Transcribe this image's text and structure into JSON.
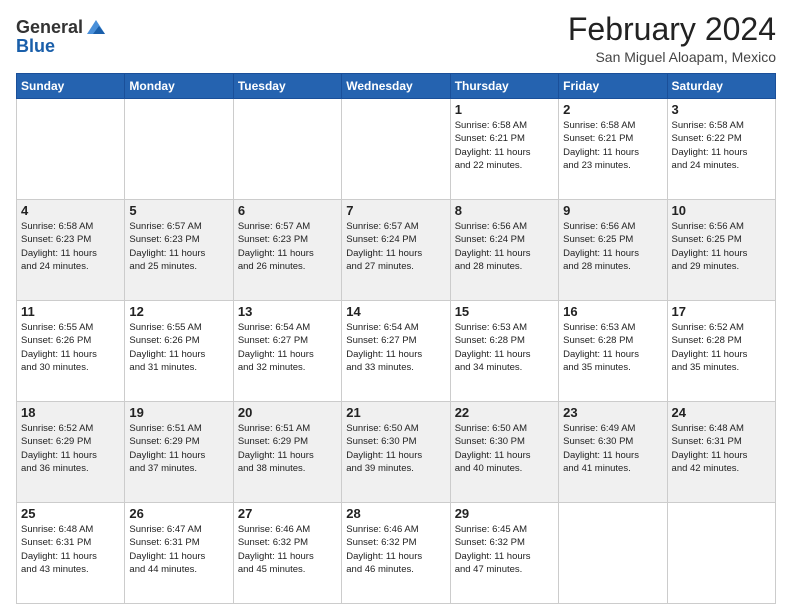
{
  "header": {
    "logo": {
      "line1": "General",
      "line2": "Blue"
    },
    "title": "February 2024",
    "location": "San Miguel Aloapam, Mexico"
  },
  "days_of_week": [
    "Sunday",
    "Monday",
    "Tuesday",
    "Wednesday",
    "Thursday",
    "Friday",
    "Saturday"
  ],
  "weeks": [
    [
      {
        "day": "",
        "info": ""
      },
      {
        "day": "",
        "info": ""
      },
      {
        "day": "",
        "info": ""
      },
      {
        "day": "",
        "info": ""
      },
      {
        "day": "1",
        "info": "Sunrise: 6:58 AM\nSunset: 6:21 PM\nDaylight: 11 hours\nand 22 minutes."
      },
      {
        "day": "2",
        "info": "Sunrise: 6:58 AM\nSunset: 6:21 PM\nDaylight: 11 hours\nand 23 minutes."
      },
      {
        "day": "3",
        "info": "Sunrise: 6:58 AM\nSunset: 6:22 PM\nDaylight: 11 hours\nand 24 minutes."
      }
    ],
    [
      {
        "day": "4",
        "info": "Sunrise: 6:58 AM\nSunset: 6:23 PM\nDaylight: 11 hours\nand 24 minutes."
      },
      {
        "day": "5",
        "info": "Sunrise: 6:57 AM\nSunset: 6:23 PM\nDaylight: 11 hours\nand 25 minutes."
      },
      {
        "day": "6",
        "info": "Sunrise: 6:57 AM\nSunset: 6:23 PM\nDaylight: 11 hours\nand 26 minutes."
      },
      {
        "day": "7",
        "info": "Sunrise: 6:57 AM\nSunset: 6:24 PM\nDaylight: 11 hours\nand 27 minutes."
      },
      {
        "day": "8",
        "info": "Sunrise: 6:56 AM\nSunset: 6:24 PM\nDaylight: 11 hours\nand 28 minutes."
      },
      {
        "day": "9",
        "info": "Sunrise: 6:56 AM\nSunset: 6:25 PM\nDaylight: 11 hours\nand 28 minutes."
      },
      {
        "day": "10",
        "info": "Sunrise: 6:56 AM\nSunset: 6:25 PM\nDaylight: 11 hours\nand 29 minutes."
      }
    ],
    [
      {
        "day": "11",
        "info": "Sunrise: 6:55 AM\nSunset: 6:26 PM\nDaylight: 11 hours\nand 30 minutes."
      },
      {
        "day": "12",
        "info": "Sunrise: 6:55 AM\nSunset: 6:26 PM\nDaylight: 11 hours\nand 31 minutes."
      },
      {
        "day": "13",
        "info": "Sunrise: 6:54 AM\nSunset: 6:27 PM\nDaylight: 11 hours\nand 32 minutes."
      },
      {
        "day": "14",
        "info": "Sunrise: 6:54 AM\nSunset: 6:27 PM\nDaylight: 11 hours\nand 33 minutes."
      },
      {
        "day": "15",
        "info": "Sunrise: 6:53 AM\nSunset: 6:28 PM\nDaylight: 11 hours\nand 34 minutes."
      },
      {
        "day": "16",
        "info": "Sunrise: 6:53 AM\nSunset: 6:28 PM\nDaylight: 11 hours\nand 35 minutes."
      },
      {
        "day": "17",
        "info": "Sunrise: 6:52 AM\nSunset: 6:28 PM\nDaylight: 11 hours\nand 35 minutes."
      }
    ],
    [
      {
        "day": "18",
        "info": "Sunrise: 6:52 AM\nSunset: 6:29 PM\nDaylight: 11 hours\nand 36 minutes."
      },
      {
        "day": "19",
        "info": "Sunrise: 6:51 AM\nSunset: 6:29 PM\nDaylight: 11 hours\nand 37 minutes."
      },
      {
        "day": "20",
        "info": "Sunrise: 6:51 AM\nSunset: 6:29 PM\nDaylight: 11 hours\nand 38 minutes."
      },
      {
        "day": "21",
        "info": "Sunrise: 6:50 AM\nSunset: 6:30 PM\nDaylight: 11 hours\nand 39 minutes."
      },
      {
        "day": "22",
        "info": "Sunrise: 6:50 AM\nSunset: 6:30 PM\nDaylight: 11 hours\nand 40 minutes."
      },
      {
        "day": "23",
        "info": "Sunrise: 6:49 AM\nSunset: 6:30 PM\nDaylight: 11 hours\nand 41 minutes."
      },
      {
        "day": "24",
        "info": "Sunrise: 6:48 AM\nSunset: 6:31 PM\nDaylight: 11 hours\nand 42 minutes."
      }
    ],
    [
      {
        "day": "25",
        "info": "Sunrise: 6:48 AM\nSunset: 6:31 PM\nDaylight: 11 hours\nand 43 minutes."
      },
      {
        "day": "26",
        "info": "Sunrise: 6:47 AM\nSunset: 6:31 PM\nDaylight: 11 hours\nand 44 minutes."
      },
      {
        "day": "27",
        "info": "Sunrise: 6:46 AM\nSunset: 6:32 PM\nDaylight: 11 hours\nand 45 minutes."
      },
      {
        "day": "28",
        "info": "Sunrise: 6:46 AM\nSunset: 6:32 PM\nDaylight: 11 hours\nand 46 minutes."
      },
      {
        "day": "29",
        "info": "Sunrise: 6:45 AM\nSunset: 6:32 PM\nDaylight: 11 hours\nand 47 minutes."
      },
      {
        "day": "",
        "info": ""
      },
      {
        "day": "",
        "info": ""
      }
    ]
  ]
}
